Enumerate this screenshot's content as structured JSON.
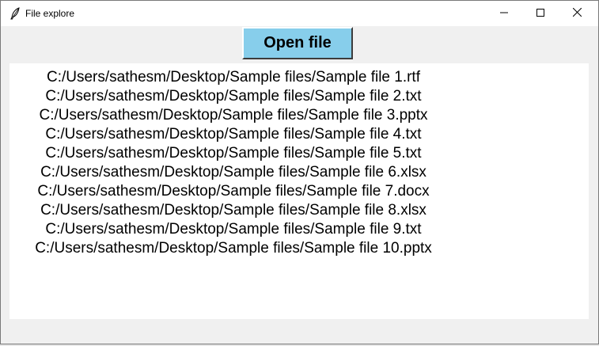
{
  "window": {
    "title": "File explore",
    "app_icon": "feather-icon",
    "controls": {
      "minimize_icon": "minimize-icon",
      "maximize_icon": "maximize-icon",
      "close_icon": "close-icon"
    }
  },
  "toolbar": {
    "open_file_label": "Open file",
    "open_file_bg": "#87ceeb"
  },
  "files": [
    "C:/Users/sathesm/Desktop/Sample files/Sample file 1.rtf",
    "C:/Users/sathesm/Desktop/Sample files/Sample file 2.txt",
    "C:/Users/sathesm/Desktop/Sample files/Sample file 3.pptx",
    "C:/Users/sathesm/Desktop/Sample files/Sample file 4.txt",
    "C:/Users/sathesm/Desktop/Sample files/Sample file 5.txt",
    "C:/Users/sathesm/Desktop/Sample files/Sample file 6.xlsx",
    "C:/Users/sathesm/Desktop/Sample files/Sample file 7.docx",
    "C:/Users/sathesm/Desktop/Sample files/Sample file 8.xlsx",
    "C:/Users/sathesm/Desktop/Sample files/Sample file 9.txt",
    "C:/Users/sathesm/Desktop/Sample files/Sample file 10.pptx"
  ]
}
